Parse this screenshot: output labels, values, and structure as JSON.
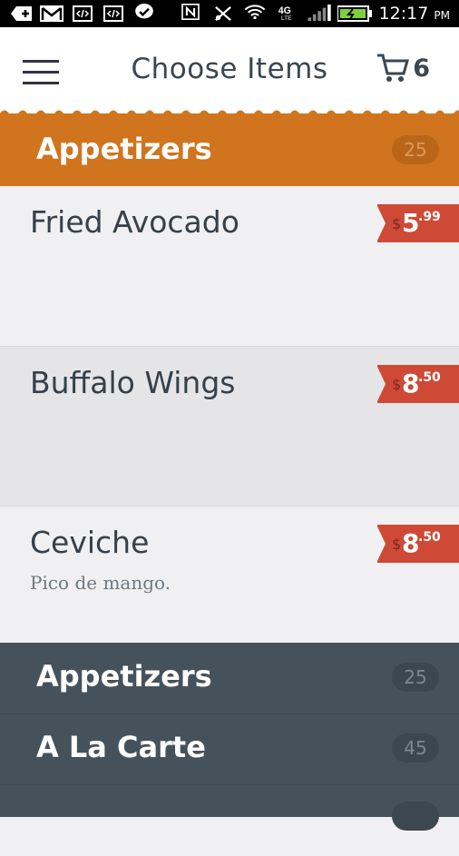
{
  "status_bar": {
    "time": "12:17",
    "ampm": "PM",
    "icons": [
      "add-icon",
      "gmail-icon",
      "code-icon",
      "code-icon",
      "messenger-icon",
      "nfc-icon",
      "mute-icon",
      "wifi-icon",
      "lte-icon",
      "signal-icon",
      "battery-icon"
    ]
  },
  "app_bar": {
    "title": "Choose Items",
    "cart_count": "6"
  },
  "colors": {
    "accent": "#d0741e",
    "price_tag": "#cf4a36",
    "drawer": "#46525b",
    "text": "#35404a"
  },
  "section": {
    "title": "Appetizers",
    "count": "25"
  },
  "items": [
    {
      "name": "Fried Avocado",
      "description": "",
      "currency": "$",
      "dollars": "5",
      "cents": ".99"
    },
    {
      "name": "Buffalo Wings",
      "description": "",
      "currency": "$",
      "dollars": "8",
      "cents": ".50"
    },
    {
      "name": "Ceviche",
      "description": "Pico de mango.",
      "currency": "$",
      "dollars": "8",
      "cents": ".50"
    }
  ],
  "drawer": {
    "categories": [
      {
        "title": "Appetizers",
        "count": "25"
      },
      {
        "title": "A La Carte",
        "count": "45"
      }
    ]
  }
}
